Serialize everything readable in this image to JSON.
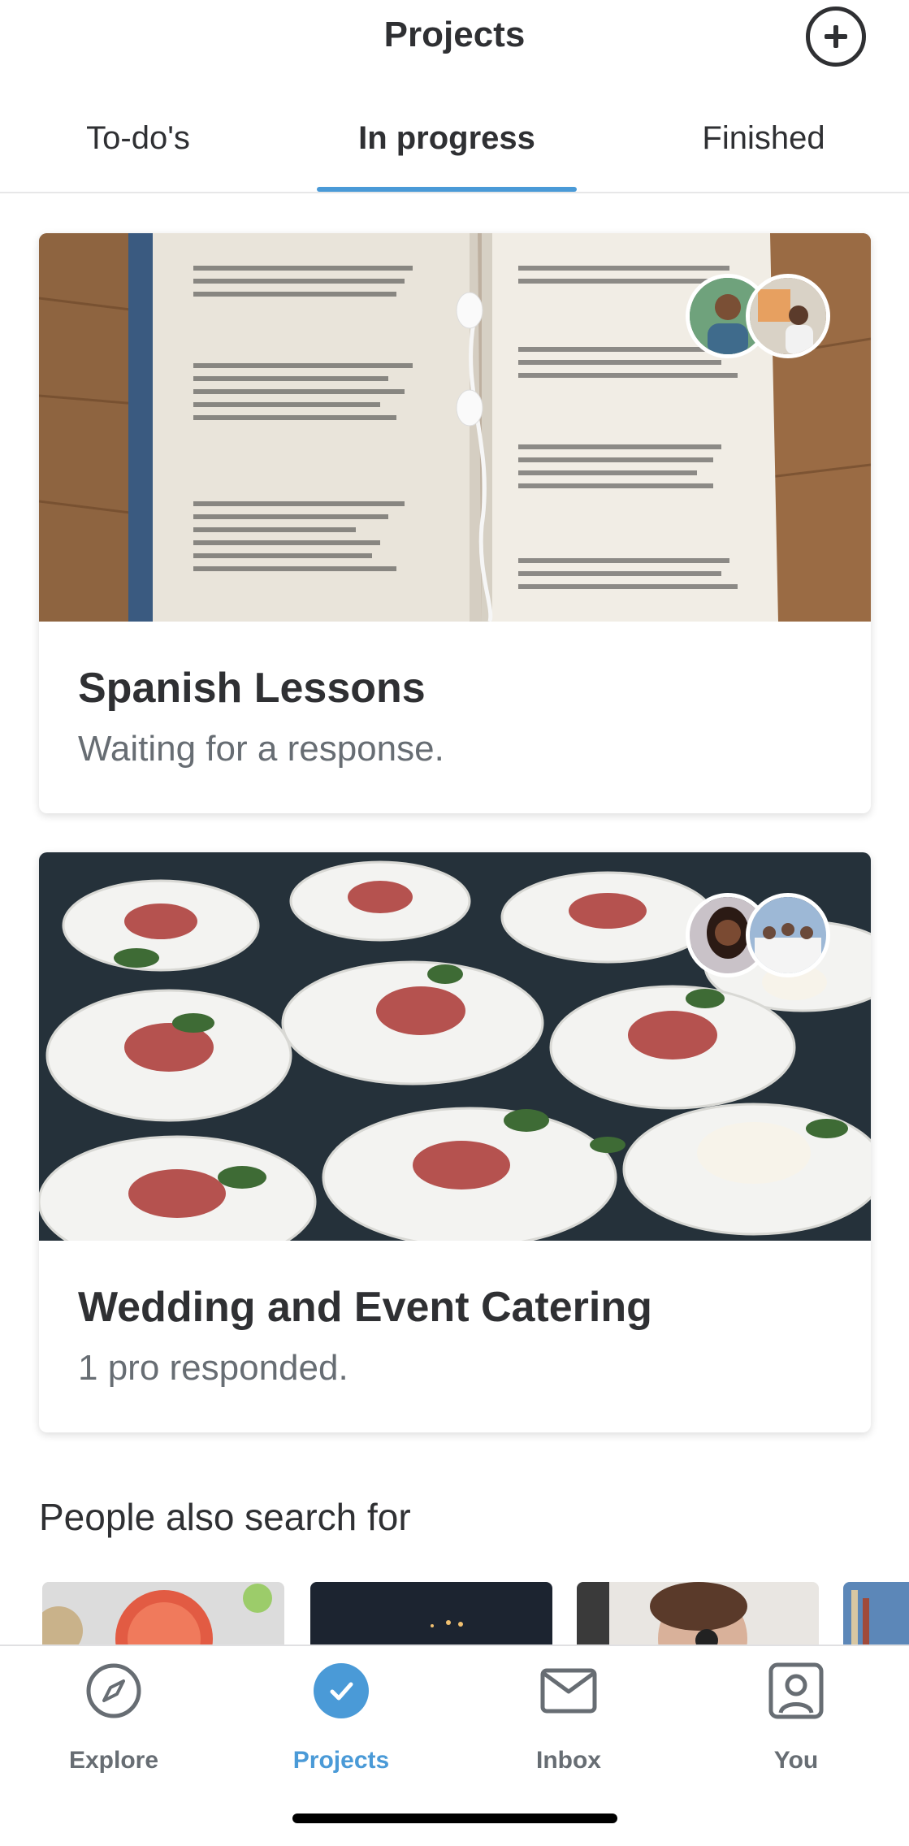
{
  "header": {
    "title": "Projects",
    "add_icon": "plus-circle-icon"
  },
  "tabs": [
    {
      "label": "To-do's",
      "active": false
    },
    {
      "label": "In progress",
      "active": true
    },
    {
      "label": "Finished",
      "active": false
    }
  ],
  "accent_color": "#4a9ad7",
  "projects": [
    {
      "title": "Spanish Lessons",
      "status": "Waiting for a response.",
      "image": "open-book-with-earphones-photo",
      "avatars": [
        "pro-avatar-man",
        "pro-avatar-booth"
      ]
    },
    {
      "title": "Wedding and Event Catering",
      "status": "1 pro responded.",
      "image": "prosciutto-appetizer-plates-photo",
      "avatars": [
        "pro-avatar-woman",
        "pro-avatar-team"
      ]
    }
  ],
  "also_search": {
    "title": "People also search for",
    "thumbnails": [
      "grapefruit-food-photo",
      "night-scene-photo",
      "eye-exam-photo",
      "shelves-photo"
    ]
  },
  "bottom_nav": [
    {
      "label": "Explore",
      "icon": "compass-icon",
      "active": false
    },
    {
      "label": "Projects",
      "icon": "check-circle-icon",
      "active": true
    },
    {
      "label": "Inbox",
      "icon": "envelope-icon",
      "active": false
    },
    {
      "label": "You",
      "icon": "user-icon",
      "active": false
    }
  ]
}
